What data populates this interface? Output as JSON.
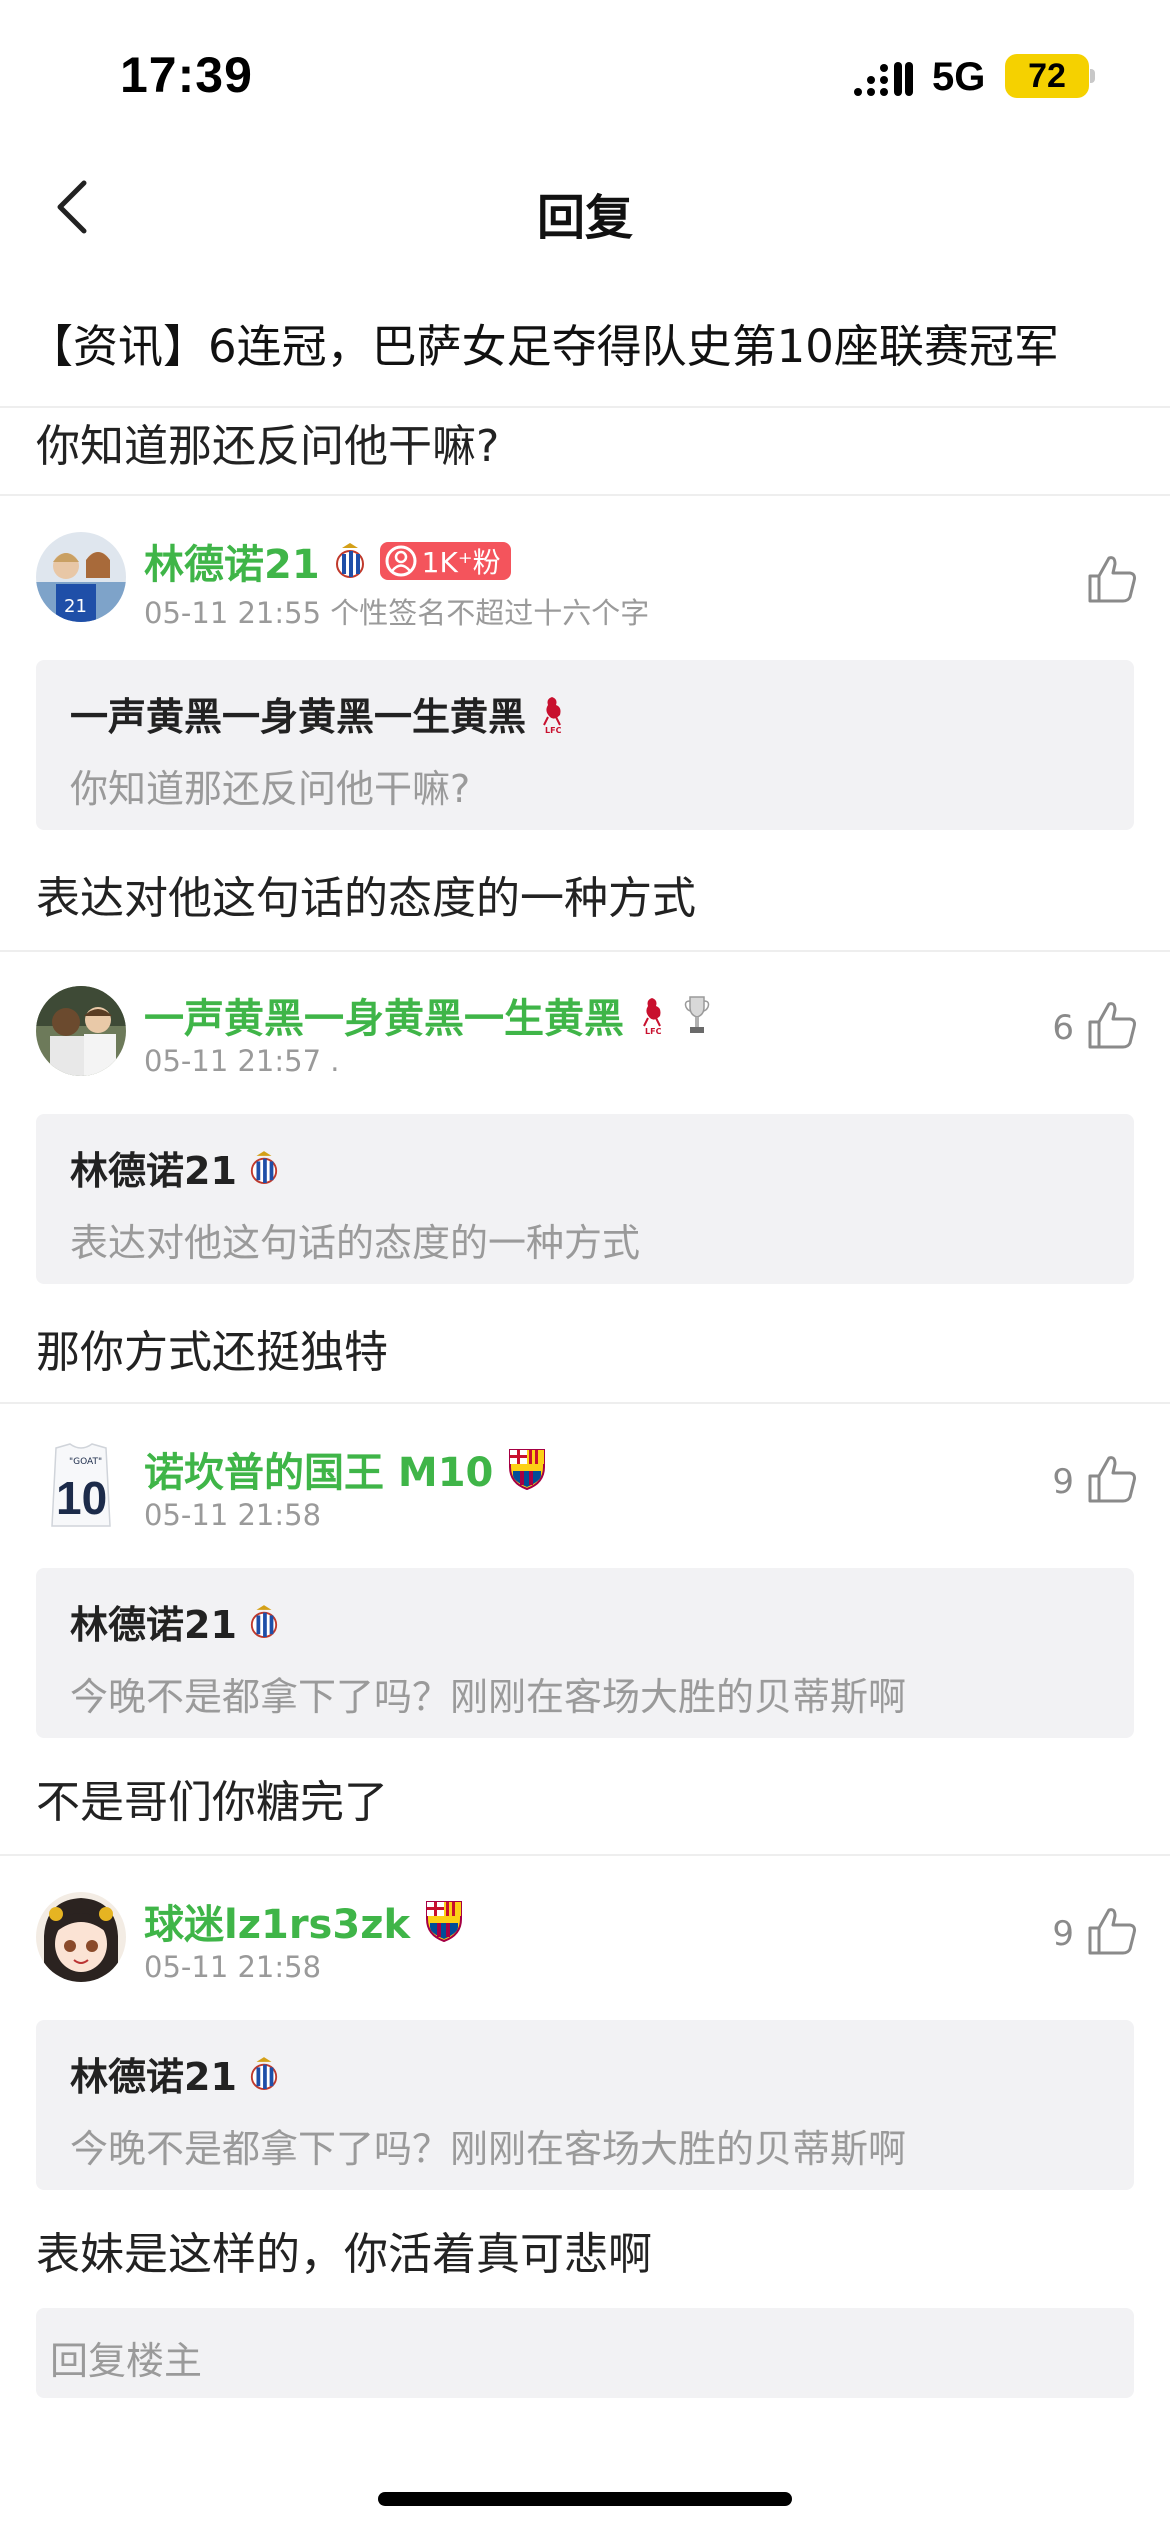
{
  "status_bar": {
    "time": "17:39",
    "network": "5G",
    "battery": "72"
  },
  "nav": {
    "title": "回复",
    "back_icon": "chevron-left-icon"
  },
  "thread": {
    "title": "【资讯】6连冠，巴萨女足夺得队史第10座联赛冠军",
    "previous_reply": "你知道那还反问他干嘛?"
  },
  "comments": [
    {
      "username": "林德诺21",
      "fans_badge": "1K⁺粉",
      "time": "05-11 21:55",
      "signature": "个性签名不超过十六个字",
      "likes": "",
      "quote_user": "一声黄黑一身黄黑一生黄黑",
      "quote_text": "你知道那还反问他干嘛?",
      "reply": "表达对他这句话的态度的一种方式"
    },
    {
      "username": "一声黄黑一身黄黑一生黄黑",
      "time": "05-11 21:57",
      "signature": ".",
      "likes": "6",
      "quote_user": "林德诺21",
      "quote_text": "表达对他这句话的态度的一种方式",
      "reply": "那你方式还挺独特"
    },
    {
      "username": "诺坎普的国王 M10",
      "time": "05-11 21:58",
      "signature": "",
      "likes": "9",
      "avatar_text": "10",
      "avatar_small": "\"GOAT\"",
      "quote_user": "林德诺21",
      "quote_text": "今晚不是都拿下了吗？刚刚在客场大胜的贝蒂斯啊",
      "reply": "不是哥们你糖完了"
    },
    {
      "username": "球迷lz1rs3zk",
      "time": "05-11 21:58",
      "signature": "",
      "likes": "9",
      "quote_user": "林德诺21",
      "quote_text": "今晚不是都拿下了吗？刚刚在客场大胜的贝蒂斯啊",
      "reply": "表妹是这样的，你活着真可悲啊"
    }
  ],
  "reply_box": {
    "placeholder": "回复楼主"
  },
  "colors": {
    "username": "#3fb548",
    "quote_bg": "#f2f2f4",
    "fans_badge": "#f4545c",
    "battery": "#f5d100"
  }
}
